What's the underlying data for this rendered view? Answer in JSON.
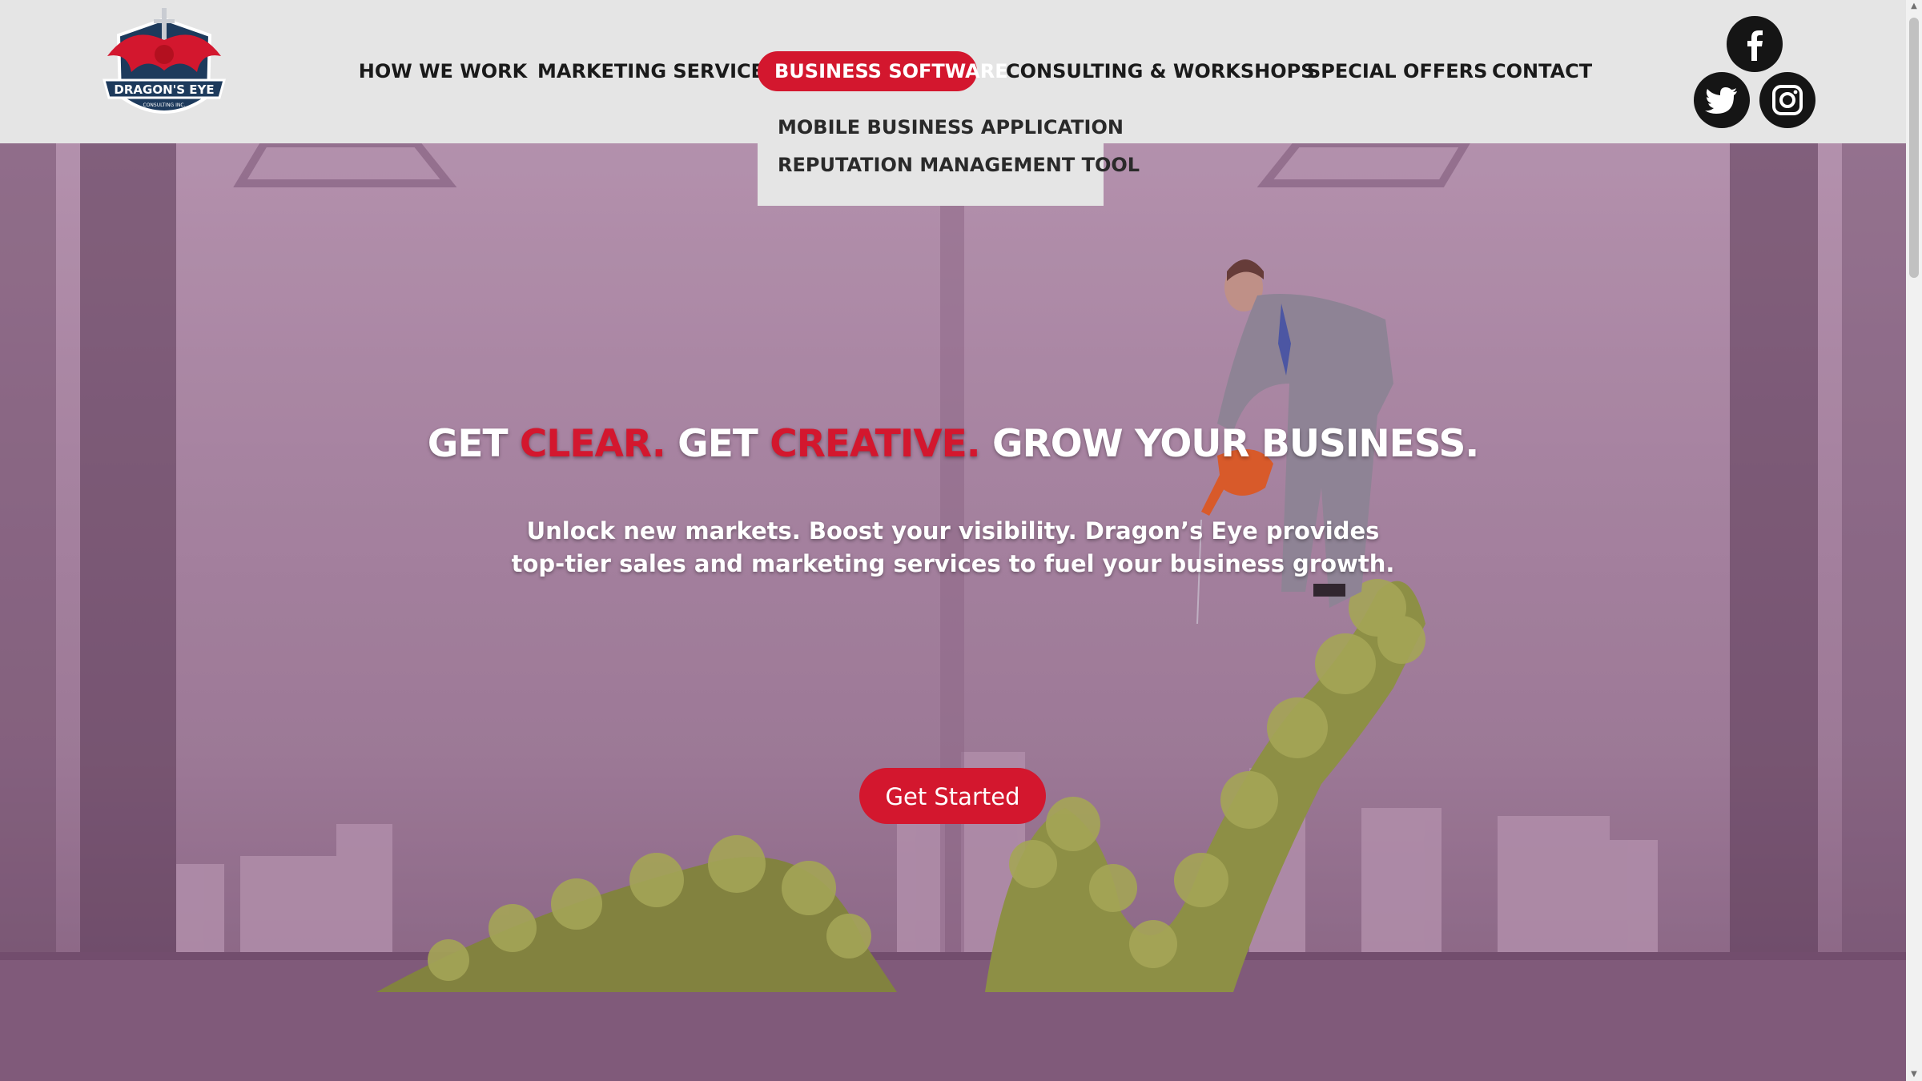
{
  "brand": {
    "logo_text": "DRAGON'S EYE",
    "logo_subtext": "CONSULTING INC."
  },
  "nav": {
    "items": [
      {
        "label": "HOW WE WORK"
      },
      {
        "label": "MARKETING SERVICES"
      },
      {
        "label": "BUSINESS SOFTWARE"
      },
      {
        "label": "CONSULTING & WORKSHOPS"
      },
      {
        "label": "SPECIAL OFFERS"
      },
      {
        "label": "CONTACT"
      }
    ],
    "dropdown": [
      {
        "label": "MOBILE BUSINESS APPLICATION"
      },
      {
        "label": "REPUTATION MANAGEMENT TOOL"
      }
    ]
  },
  "social": [
    "facebook-icon",
    "twitter-icon",
    "instagram-icon"
  ],
  "hero": {
    "headline": {
      "get1": "GET",
      "clear": "CLEAR.",
      "get2": "GET",
      "creative": "CREATIVE.",
      "grow": "GROW YOUR BUSINESS."
    },
    "subtext_line1": "Unlock new markets. Boost your visibility. Dragon’s Eye provides",
    "subtext_line2": "top-tier sales and marketing services to fuel your business growth.",
    "cta_label": "Get Started"
  },
  "colors": {
    "accent": "#d3172e",
    "header_bg": "#e5e5e5",
    "hero_tint": "#a98ba4"
  }
}
